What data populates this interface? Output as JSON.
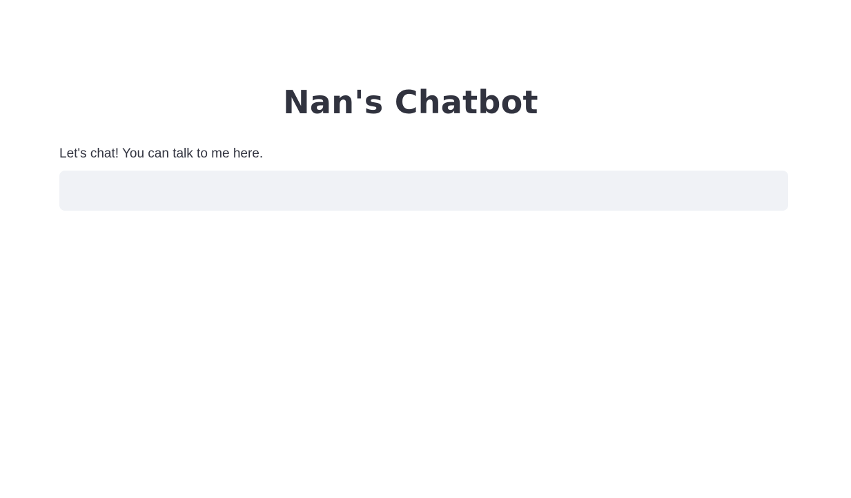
{
  "header": {
    "title": "Nan's Chatbot"
  },
  "main": {
    "intro_text": "Let's chat! You can talk to me here.",
    "input": {
      "value": "",
      "placeholder": ""
    }
  },
  "colors": {
    "text": "#31333f",
    "input_background": "#f0f2f6",
    "page_background": "#ffffff"
  }
}
